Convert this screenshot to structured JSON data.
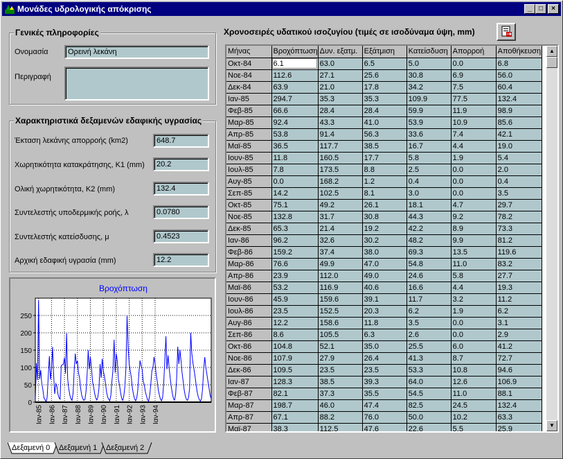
{
  "window": {
    "title": "Μονάδες υδρολογικής απόκρισης",
    "minimize": "_",
    "maximize": "□",
    "close": "×"
  },
  "general": {
    "title": "Γενικές πληροφορίες",
    "name_label": "Ονομασία",
    "name_value": "Ορεινή λεκάνη",
    "desc_label": "Περιγραφή",
    "desc_value": ""
  },
  "reservoir": {
    "title": "Χαρακτηριστικά δεξαμενών εδαφικής υγρασίας",
    "params": [
      {
        "label": "Έκταση λεκάνης απορροής (km2)",
        "value": "648.7"
      },
      {
        "label": "Χωρητικότητα κατακράτησης, Κ1 (mm)",
        "value": "20.2"
      },
      {
        "label": "Ολική χωρητικότητα, Κ2 (mm)",
        "value": "132.4"
      },
      {
        "label": "Συντελεστής υποδερμικής ροής, λ",
        "value": "0.0780"
      },
      {
        "label": "Συντελεστής κατείσδυσης, μ",
        "value": "0.4523"
      },
      {
        "label": "Αρχική εδαφική υγρασία (mm)",
        "value": "12.2"
      }
    ]
  },
  "chart_data": {
    "type": "line",
    "title": "Βροχόπτωση",
    "xlabel": "",
    "ylabel": "",
    "ylim": [
      0,
      300
    ],
    "yticks": [
      "0",
      "50",
      "100",
      "150",
      "200",
      "250"
    ],
    "xticks": [
      "Ιαν-85",
      "Ιαν-86",
      "Ιαν-87",
      "Ιαν-88",
      "Ιαν-89",
      "Ιαν-90",
      "Ιαν-91",
      "Ιαν-92",
      "Ιαν-93",
      "Ιαν-94"
    ],
    "x_start_label": "Οκτ-84",
    "grid": true,
    "color": "#0000ff",
    "series": [
      {
        "values": [
          6.1,
          112.6,
          63.9,
          294.7,
          66.6,
          92.4,
          53.8,
          36.5,
          11.8,
          7.8,
          0.0,
          14.2,
          75.1,
          132.8,
          65.3,
          96.2,
          159.2,
          76.6,
          23.9,
          53.2,
          45.9,
          23.5,
          12.2,
          8.6,
          104.8,
          107.9,
          109.5,
          128.3,
          82.1,
          198.7,
          67.1,
          38.3,
          20,
          10,
          5,
          25,
          90,
          140,
          110,
          120,
          85,
          70,
          40,
          20,
          10,
          5,
          8,
          30,
          80,
          150,
          95,
          130,
          100,
          60,
          45,
          25,
          12,
          6,
          15,
          40,
          110,
          70,
          125,
          90,
          75,
          55,
          30,
          15,
          8,
          4,
          20,
          60,
          95,
          180,
          85,
          140,
          120,
          65,
          50,
          28,
          10,
          5,
          18,
          45,
          100,
          250,
          160,
          110,
          90,
          70,
          40,
          22,
          9,
          4,
          12,
          35,
          85,
          120,
          105,
          95,
          60,
          50,
          30,
          18,
          7,
          3,
          20,
          50,
          90,
          100,
          130,
          110,
          80,
          60,
          35,
          20,
          8,
          4,
          15,
          55,
          120,
          190,
          95,
          135,
          100,
          70,
          45,
          25,
          10,
          6,
          22,
          70,
          160,
          110,
          150,
          120,
          85,
          60,
          35,
          18,
          8,
          5,
          14,
          40,
          200,
          140,
          115,
          95,
          75,
          50,
          30,
          15,
          7,
          3,
          10,
          38,
          95,
          130,
          100,
          80,
          60,
          40,
          20,
          10
        ]
      }
    ]
  },
  "table": {
    "title": "Χρονοσειρές υδατικού ισοζυγίου (τιμές σε ισοδύναμα ύψη, mm)",
    "columns": [
      "Μήνας",
      "Βροχόπτωση",
      "Δυν. εξατμ.",
      "Εξάτμιση",
      "Κατείσδυση",
      "Απορροή",
      "Αποθήκευση"
    ],
    "rows": [
      [
        "Οκτ-84",
        "6.1",
        "63.0",
        "6.5",
        "5.0",
        "0.0",
        "6.8"
      ],
      [
        "Νοε-84",
        "112.6",
        "27.1",
        "25.6",
        "30.8",
        "6.9",
        "56.0"
      ],
      [
        "Δεκ-84",
        "63.9",
        "21.0",
        "17.8",
        "34.2",
        "7.5",
        "60.4"
      ],
      [
        "Ιαν-85",
        "294.7",
        "35.3",
        "35.3",
        "109.9",
        "77.5",
        "132.4"
      ],
      [
        "Φεβ-85",
        "66.6",
        "28.4",
        "28.4",
        "59.9",
        "11.9",
        "98.9"
      ],
      [
        "Μαρ-85",
        "92.4",
        "43.3",
        "41.0",
        "53.9",
        "10.9",
        "85.6"
      ],
      [
        "Απρ-85",
        "53.8",
        "91.4",
        "56.3",
        "33.6",
        "7.4",
        "42.1"
      ],
      [
        "Μαϊ-85",
        "36.5",
        "117.7",
        "38.5",
        "16.7",
        "4.4",
        "19.0"
      ],
      [
        "Ιουν-85",
        "11.8",
        "160.5",
        "17.7",
        "5.8",
        "1.9",
        "5.4"
      ],
      [
        "Ιουλ-85",
        "7.8",
        "173.5",
        "8.8",
        "2.5",
        "0.0",
        "2.0"
      ],
      [
        "Αυγ-85",
        "0.0",
        "168.2",
        "1.2",
        "0.4",
        "0.0",
        "0.4"
      ],
      [
        "Σεπ-85",
        "14.2",
        "102.5",
        "8.1",
        "3.0",
        "0.0",
        "3.5"
      ],
      [
        "Οκτ-85",
        "75.1",
        "49.2",
        "26.1",
        "18.1",
        "4.7",
        "29.7"
      ],
      [
        "Νοε-85",
        "132.8",
        "31.7",
        "30.8",
        "44.3",
        "9.2",
        "78.2"
      ],
      [
        "Δεκ-85",
        "65.3",
        "21.4",
        "19.2",
        "42.2",
        "8.9",
        "73.3"
      ],
      [
        "Ιαν-86",
        "96.2",
        "32.6",
        "30.2",
        "48.2",
        "9.9",
        "81.2"
      ],
      [
        "Φεβ-86",
        "159.2",
        "37.4",
        "38.0",
        "69.3",
        "13.5",
        "119.6"
      ],
      [
        "Μαρ-86",
        "76.6",
        "49.9",
        "47.0",
        "54.8",
        "11.0",
        "83.2"
      ],
      [
        "Απρ-86",
        "23.9",
        "112.0",
        "49.0",
        "24.6",
        "5.8",
        "27.7"
      ],
      [
        "Μαϊ-86",
        "53.2",
        "116.9",
        "40.6",
        "16.6",
        "4.4",
        "19.3"
      ],
      [
        "Ιουν-86",
        "45.9",
        "159.6",
        "39.1",
        "11.7",
        "3.2",
        "11.2"
      ],
      [
        "Ιουλ-86",
        "23.5",
        "152.5",
        "20.3",
        "6.2",
        "1.9",
        "6.2"
      ],
      [
        "Αυγ-86",
        "12.2",
        "158.6",
        "11.8",
        "3.5",
        "0.0",
        "3.1"
      ],
      [
        "Σεπ-86",
        "8.6",
        "105.5",
        "6.3",
        "2.6",
        "0.0",
        "2.9"
      ],
      [
        "Οκτ-86",
        "104.8",
        "52.1",
        "35.0",
        "25.5",
        "6.0",
        "41.2"
      ],
      [
        "Νοε-86",
        "107.9",
        "27.9",
        "26.4",
        "41.3",
        "8.7",
        "72.7"
      ],
      [
        "Δεκ-86",
        "109.5",
        "23.5",
        "23.5",
        "53.3",
        "10.8",
        "94.6"
      ],
      [
        "Ιαν-87",
        "128.3",
        "38.5",
        "39.3",
        "64.0",
        "12.6",
        "106.9"
      ],
      [
        "Φεβ-87",
        "82.1",
        "37.3",
        "35.5",
        "54.5",
        "11.0",
        "88.1"
      ],
      [
        "Μαρ-87",
        "198.7",
        "46.0",
        "47.4",
        "82.5",
        "24.5",
        "132.4"
      ],
      [
        "Απρ-87",
        "67.1",
        "88.2",
        "76.0",
        "50.0",
        "10.2",
        "63.3"
      ],
      [
        "Μαϊ-87",
        "38.3",
        "112.5",
        "47.6",
        "22.6",
        "5.5",
        "25.9"
      ]
    ]
  },
  "tabs": [
    "Δεξαμενή 0",
    "Δεξαμενή 1",
    "Δεξαμενή 2"
  ]
}
